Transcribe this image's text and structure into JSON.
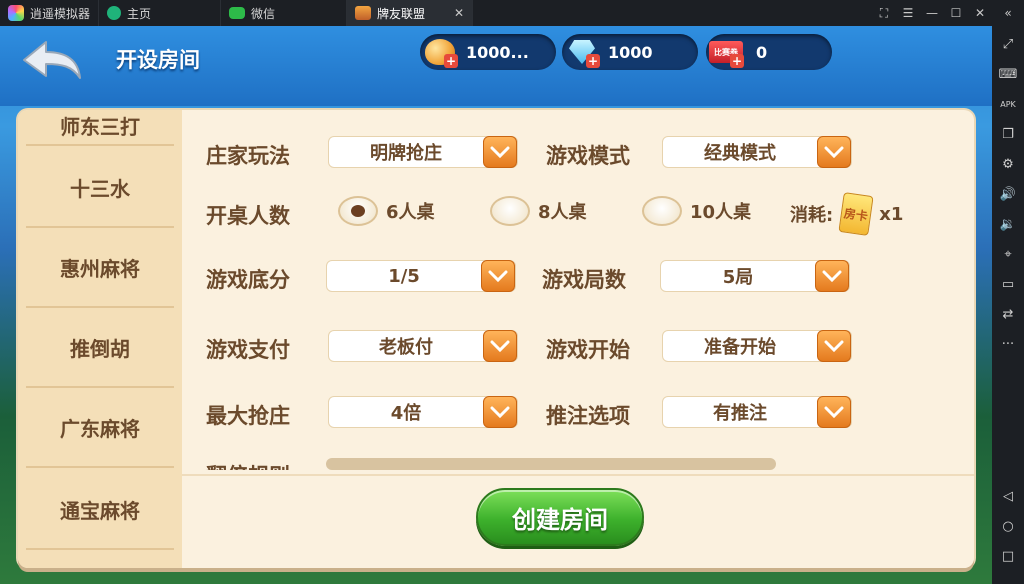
{
  "emulator": {
    "tabs": [
      {
        "label": "逍遥模拟器",
        "icon": "emulator-logo-icon"
      },
      {
        "label": "主页",
        "icon": "home-icon"
      },
      {
        "label": "微信",
        "icon": "wechat-icon"
      },
      {
        "label": "牌友联盟",
        "icon": "game-icon"
      }
    ],
    "window_buttons": [
      "fullscreen-icon",
      "menu-icon",
      "minimize-icon",
      "maximize-icon",
      "close-icon"
    ],
    "collapse_label": "«"
  },
  "sidebar": {
    "tools": [
      "expand-icon",
      "keyboard-icon",
      "apk-icon",
      "multi-window-icon",
      "settings-icon",
      "volume-up-icon",
      "volume-down-icon",
      "location-icon",
      "folder-icon",
      "sync-icon",
      "more-icon"
    ],
    "nav": [
      "back-icon",
      "home-circle-icon",
      "recent-apps-icon"
    ],
    "apk_label": "APK",
    "more_label": "···"
  },
  "header": {
    "title": "开设房间",
    "gold": "1000...",
    "diamond": "1000",
    "ticket": "0",
    "ticket_icon_text": "比赛券"
  },
  "games": [
    "师东三打",
    "十三水",
    "惠州麻将",
    "推倒胡",
    "广东麻将",
    "通宝麻将"
  ],
  "settings": {
    "banker_label": "庄家玩法",
    "banker_value": "明牌抢庄",
    "mode_label": "游戏模式",
    "mode_value": "经典模式",
    "players_label": "开桌人数",
    "players_options": [
      "6人桌",
      "8人桌",
      "10人桌"
    ],
    "players_selected": "6人桌",
    "consume_label": "消耗:",
    "consume_card_text": "房卡",
    "consume_amount": "x1",
    "base_label": "游戏底分",
    "base_value": "1/5",
    "rounds_label": "游戏局数",
    "rounds_value": "5局",
    "pay_label": "游戏支付",
    "pay_value": "老板付",
    "start_label": "游戏开始",
    "start_value": "准备开始",
    "max_grab_label": "最大抢庄",
    "max_grab_value": "4倍",
    "bet_label": "推注选项",
    "bet_value": "有推注",
    "partial_label": "翻倍规则"
  },
  "create_button": "创建房间",
  "colors": {
    "panel_bg": "#fbf1df",
    "text_brown": "#6b4a2c",
    "orange_arrow": "#e47a1e",
    "create_green": "#3db12c",
    "topbar_blue": "#1f70c4"
  }
}
